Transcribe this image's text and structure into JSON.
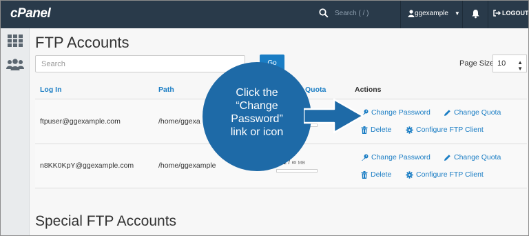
{
  "topbar": {
    "logo": "cPanel",
    "search_placeholder": "Search ( / )",
    "username": "ggexample",
    "logout_label": "LOGOUT"
  },
  "page": {
    "title": "FTP Accounts",
    "search_placeholder": "Search",
    "go_label": "Go",
    "page_size_label": "Page Size",
    "page_size_value": "10"
  },
  "table": {
    "headers": {
      "login": "Log In",
      "path": "Path",
      "quota": "Quota",
      "actions": "Actions"
    },
    "rows": [
      {
        "login": "ftpuser@ggexample.com",
        "path": "/home/ggexa",
        "quota": "",
        "actions": [
          "Change Password",
          "Change Quota",
          "Delete",
          "Configure FTP Client"
        ]
      },
      {
        "login": "n8KK0KpY@ggexample.com",
        "path": "/home/ggexample",
        "quota_used": "001",
        "quota_sep": "/",
        "quota_limit": "∞",
        "quota_unit": "MB",
        "actions": [
          "Change Password",
          "Change Quota",
          "Delete",
          "Configure FTP Client"
        ]
      }
    ]
  },
  "special_title": "Special FTP Accounts",
  "callout": {
    "lines": [
      "Click the",
      "“Change",
      "Password”",
      "link or icon"
    ]
  },
  "icons": [
    "search-icon",
    "user-icon",
    "bell-icon",
    "logout-icon",
    "grid-icon",
    "users-icon",
    "key-icon",
    "pencil-icon",
    "trash-icon",
    "gear-icon"
  ],
  "colors": {
    "topbar": "#293a4a",
    "link": "#1a7dc4",
    "callout": "#1e6aa7"
  }
}
